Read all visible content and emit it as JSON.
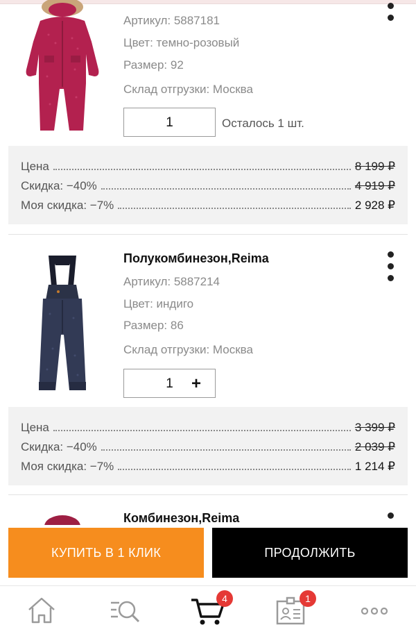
{
  "items": [
    {
      "title": "",
      "article": "Артикул: 5887181",
      "color": "Цвет: темно-розовый",
      "size": "Размер: 92",
      "warehouse": "Склад отгрузки: Москва",
      "quantity": "1",
      "stock_note": "Осталось 1 шт.",
      "price_label": "Цена",
      "price_value": "8 199 ₽",
      "discount_label": "Скидка: −40%",
      "discount_value": "4 919 ₽",
      "my_discount_label": "Моя скидка: −7%",
      "my_discount_value": "2 928 ₽",
      "image_icon": "pink-snowsuit-image"
    },
    {
      "title": "Полукомбинезон,Reima",
      "article": "Артикул: 5887214",
      "color": "Цвет: индиго",
      "size": "Размер: 86",
      "warehouse": "Склад отгрузки: Москва",
      "quantity": "1",
      "plus": "+",
      "price_label": "Цена",
      "price_value": "3 399 ₽",
      "discount_label": "Скидка: −40%",
      "discount_value": "2 039 ₽",
      "my_discount_label": "Моя скидка: −7%",
      "my_discount_value": "1 214 ₽",
      "image_icon": "indigo-bib-pants-image"
    },
    {
      "title": "Комбинезон,Reima",
      "image_icon": "snowsuit-image-partial"
    }
  ],
  "actions": {
    "buy_one_click": "КУПИТЬ В 1 КЛИК",
    "continue": "ПРОДОЛЖИТЬ"
  },
  "tabbar": {
    "cart_badge": "4",
    "profile_badge": "1",
    "icons": [
      "home-icon",
      "search-icon",
      "cart-icon",
      "profile-card-icon",
      "more-icon"
    ]
  },
  "colors": {
    "accent_orange": "#f68d1e",
    "black": "#000000",
    "badge_red": "#e53935",
    "price_box_bg": "#f2f2f2"
  }
}
